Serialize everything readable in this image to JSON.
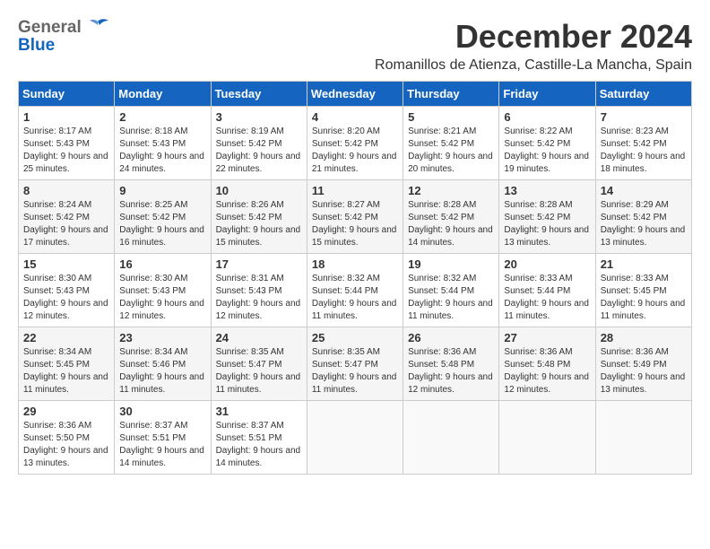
{
  "header": {
    "logo_general": "General",
    "logo_blue": "Blue",
    "title": "December 2024",
    "subtitle": "Romanillos de Atienza, Castille-La Mancha, Spain"
  },
  "calendar": {
    "days_of_week": [
      "Sunday",
      "Monday",
      "Tuesday",
      "Wednesday",
      "Thursday",
      "Friday",
      "Saturday"
    ],
    "weeks": [
      [
        {
          "day": "1",
          "sunrise": "8:17 AM",
          "sunset": "5:43 PM",
          "daylight": "9 hours and 25 minutes."
        },
        {
          "day": "2",
          "sunrise": "8:18 AM",
          "sunset": "5:43 PM",
          "daylight": "9 hours and 24 minutes."
        },
        {
          "day": "3",
          "sunrise": "8:19 AM",
          "sunset": "5:42 PM",
          "daylight": "9 hours and 22 minutes."
        },
        {
          "day": "4",
          "sunrise": "8:20 AM",
          "sunset": "5:42 PM",
          "daylight": "9 hours and 21 minutes."
        },
        {
          "day": "5",
          "sunrise": "8:21 AM",
          "sunset": "5:42 PM",
          "daylight": "9 hours and 20 minutes."
        },
        {
          "day": "6",
          "sunrise": "8:22 AM",
          "sunset": "5:42 PM",
          "daylight": "9 hours and 19 minutes."
        },
        {
          "day": "7",
          "sunrise": "8:23 AM",
          "sunset": "5:42 PM",
          "daylight": "9 hours and 18 minutes."
        }
      ],
      [
        {
          "day": "8",
          "sunrise": "8:24 AM",
          "sunset": "5:42 PM",
          "daylight": "9 hours and 17 minutes."
        },
        {
          "day": "9",
          "sunrise": "8:25 AM",
          "sunset": "5:42 PM",
          "daylight": "9 hours and 16 minutes."
        },
        {
          "day": "10",
          "sunrise": "8:26 AM",
          "sunset": "5:42 PM",
          "daylight": "9 hours and 15 minutes."
        },
        {
          "day": "11",
          "sunrise": "8:27 AM",
          "sunset": "5:42 PM",
          "daylight": "9 hours and 15 minutes."
        },
        {
          "day": "12",
          "sunrise": "8:28 AM",
          "sunset": "5:42 PM",
          "daylight": "9 hours and 14 minutes."
        },
        {
          "day": "13",
          "sunrise": "8:28 AM",
          "sunset": "5:42 PM",
          "daylight": "9 hours and 13 minutes."
        },
        {
          "day": "14",
          "sunrise": "8:29 AM",
          "sunset": "5:42 PM",
          "daylight": "9 hours and 13 minutes."
        }
      ],
      [
        {
          "day": "15",
          "sunrise": "8:30 AM",
          "sunset": "5:43 PM",
          "daylight": "9 hours and 12 minutes."
        },
        {
          "day": "16",
          "sunrise": "8:30 AM",
          "sunset": "5:43 PM",
          "daylight": "9 hours and 12 minutes."
        },
        {
          "day": "17",
          "sunrise": "8:31 AM",
          "sunset": "5:43 PM",
          "daylight": "9 hours and 12 minutes."
        },
        {
          "day": "18",
          "sunrise": "8:32 AM",
          "sunset": "5:44 PM",
          "daylight": "9 hours and 11 minutes."
        },
        {
          "day": "19",
          "sunrise": "8:32 AM",
          "sunset": "5:44 PM",
          "daylight": "9 hours and 11 minutes."
        },
        {
          "day": "20",
          "sunrise": "8:33 AM",
          "sunset": "5:44 PM",
          "daylight": "9 hours and 11 minutes."
        },
        {
          "day": "21",
          "sunrise": "8:33 AM",
          "sunset": "5:45 PM",
          "daylight": "9 hours and 11 minutes."
        }
      ],
      [
        {
          "day": "22",
          "sunrise": "8:34 AM",
          "sunset": "5:45 PM",
          "daylight": "9 hours and 11 minutes."
        },
        {
          "day": "23",
          "sunrise": "8:34 AM",
          "sunset": "5:46 PM",
          "daylight": "9 hours and 11 minutes."
        },
        {
          "day": "24",
          "sunrise": "8:35 AM",
          "sunset": "5:47 PM",
          "daylight": "9 hours and 11 minutes."
        },
        {
          "day": "25",
          "sunrise": "8:35 AM",
          "sunset": "5:47 PM",
          "daylight": "9 hours and 11 minutes."
        },
        {
          "day": "26",
          "sunrise": "8:36 AM",
          "sunset": "5:48 PM",
          "daylight": "9 hours and 12 minutes."
        },
        {
          "day": "27",
          "sunrise": "8:36 AM",
          "sunset": "5:48 PM",
          "daylight": "9 hours and 12 minutes."
        },
        {
          "day": "28",
          "sunrise": "8:36 AM",
          "sunset": "5:49 PM",
          "daylight": "9 hours and 13 minutes."
        }
      ],
      [
        {
          "day": "29",
          "sunrise": "8:36 AM",
          "sunset": "5:50 PM",
          "daylight": "9 hours and 13 minutes."
        },
        {
          "day": "30",
          "sunrise": "8:37 AM",
          "sunset": "5:51 PM",
          "daylight": "9 hours and 14 minutes."
        },
        {
          "day": "31",
          "sunrise": "8:37 AM",
          "sunset": "5:51 PM",
          "daylight": "9 hours and 14 minutes."
        },
        null,
        null,
        null,
        null
      ]
    ]
  }
}
